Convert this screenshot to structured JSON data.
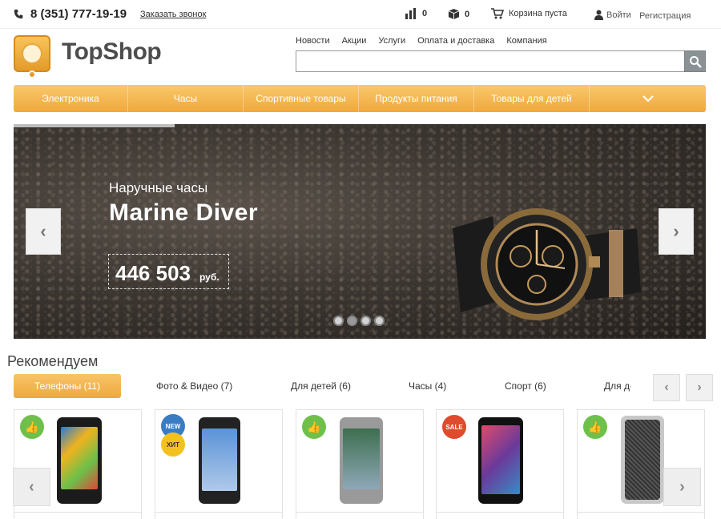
{
  "topbar": {
    "phone": "8 (351) 777-19-19",
    "callback_label": "Заказать звонок",
    "compare_count": "0",
    "favorites_count": "0",
    "cart_label": "Корзина пуста",
    "login_label": "Войти",
    "register_label": "Регистрация"
  },
  "header": {
    "logo_text": "TopShop",
    "nav": [
      "Новости",
      "Акции",
      "Услуги",
      "Оплата и доставка",
      "Компания"
    ],
    "search_placeholder": ""
  },
  "categories": [
    "Электроника",
    "Часы",
    "Спортивные товары",
    "Продукты питания",
    "Товары для детей"
  ],
  "slider": {
    "subtitle": "Наручные часы",
    "title": "Marine Diver",
    "price": "446 503",
    "currency": "руб.",
    "slide_count": 4,
    "active_slide": 2
  },
  "recommend": {
    "title": "Рекомендуем",
    "tabs": [
      "Телефоны (11)",
      "Фото & Видео (7)",
      "Для детей (6)",
      "Часы (4)",
      "Спорт (6)",
      "Для де"
    ]
  },
  "products": [
    {
      "badges": [
        "like"
      ]
    },
    {
      "badges": [
        "NEW",
        "ХИТ"
      ]
    },
    {
      "badges": [
        "like"
      ]
    },
    {
      "badges": [
        "SALE"
      ]
    },
    {
      "badges": [
        "like"
      ]
    }
  ],
  "colors": {
    "accent": "#f0a83c",
    "like_badge": "#6fc04b",
    "new_badge": "#3a7cc4",
    "hit_badge": "#f4c21e",
    "sale_badge": "#e04a2d"
  },
  "icons": {
    "phone": "phone-icon",
    "compare": "bar-chart-icon",
    "favorites": "box-icon",
    "cart": "cart-icon",
    "user": "user-icon",
    "search": "search-icon",
    "more": "chevron-down-icon",
    "like": "thumbs-up-icon"
  }
}
